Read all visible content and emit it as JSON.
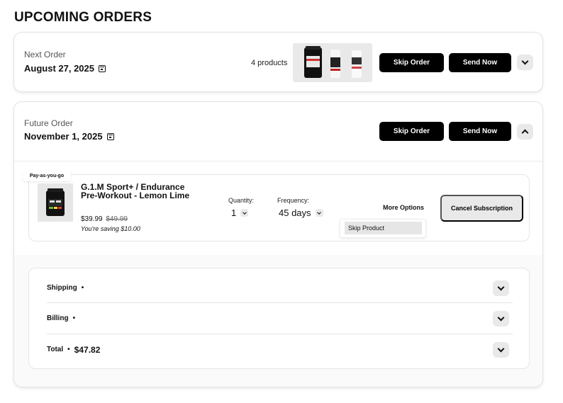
{
  "page": {
    "title": "UPCOMING ORDERS"
  },
  "next_order": {
    "label": "Next Order",
    "date": "August 27, 2025",
    "products_count": "4 products",
    "skip_label": "Skip Order",
    "send_label": "Send Now"
  },
  "future_order": {
    "label": "Future Order",
    "date": "November 1, 2025",
    "skip_label": "Skip Order",
    "send_label": "Send Now",
    "item": {
      "badge": "Pay-as-you-go",
      "name": "G.1.M Sport+ / Endurance Pre-Workout - Lemon Lime",
      "price": "$39.99",
      "old_price": "$49.99",
      "saving": "You're saving $10.00",
      "quantity_label": "Quantity:",
      "quantity_value": "1",
      "frequency_label": "Frequency:",
      "frequency_value": "45 days",
      "more_options": "More Options",
      "dropdown_item": "Skip Product",
      "cancel_label": "Cancel Subscription"
    },
    "summary": {
      "shipping_label": "Shipping",
      "billing_label": "Billing",
      "total_label": "Total",
      "total_value": "$47.82",
      "separator": "•"
    }
  },
  "icons": {
    "calendar": "calendar-icon",
    "expand": "chevron-down-icon",
    "collapse": "chevron-up-icon"
  }
}
